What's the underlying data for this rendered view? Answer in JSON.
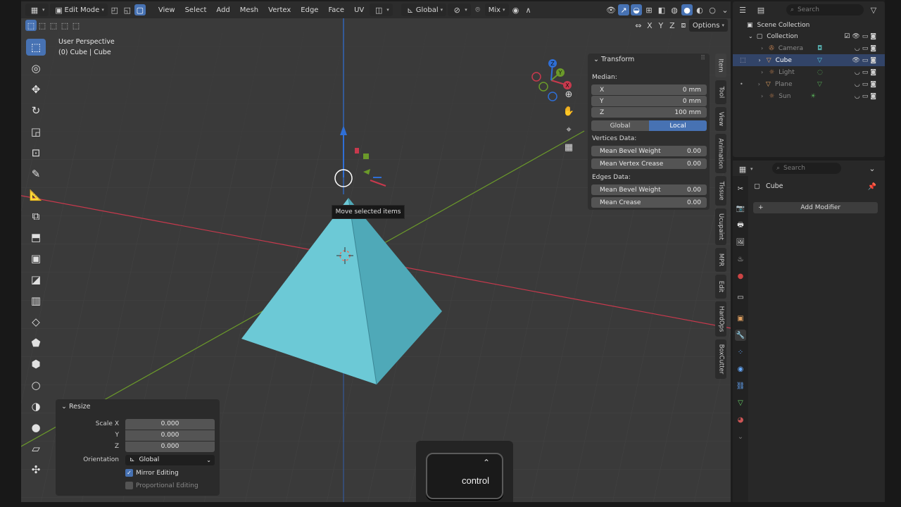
{
  "header": {
    "editor_icon": "▦",
    "mode": "Edit Mode",
    "menus": [
      "View",
      "Select",
      "Add",
      "Mesh",
      "Vertex",
      "Edge",
      "Face",
      "UV"
    ],
    "transform_orientation": "Global",
    "snap_label": "Mix",
    "options_label": "Options",
    "axes": [
      "X",
      "Y",
      "Z"
    ]
  },
  "viewport": {
    "view_name": "User Perspective",
    "object_info": "(0) Cube | Cube",
    "tooltip": "Move selected items",
    "gizmo_axes": [
      "X",
      "Y",
      "Z"
    ]
  },
  "npanel": {
    "section": "Transform",
    "median_label": "Median:",
    "fields": [
      {
        "label": "X",
        "value": "0 mm"
      },
      {
        "label": "Y",
        "value": "0 mm"
      },
      {
        "label": "Z",
        "value": "100 mm"
      }
    ],
    "seg_global": "Global",
    "seg_local": "Local",
    "vertices_label": "Vertices Data:",
    "vertices_fields": [
      {
        "label": "Mean Bevel Weight",
        "value": "0.00"
      },
      {
        "label": "Mean Vertex Crease",
        "value": "0.00"
      }
    ],
    "edges_label": "Edges Data:",
    "edges_fields": [
      {
        "label": "Mean Bevel Weight",
        "value": "0.00"
      },
      {
        "label": "Mean Crease",
        "value": "0.00"
      }
    ],
    "tabs": [
      "Item",
      "Tool",
      "View",
      "Animation",
      "Tissue",
      "Ucupaint",
      "MPR",
      "Edit",
      "HardOps",
      "BoxCutter"
    ]
  },
  "resize_panel": {
    "title": "Resize",
    "scale_x_label": "Scale X",
    "y_label": "Y",
    "z_label": "Z",
    "scale_x": "0.000",
    "scale_y": "0.000",
    "scale_z": "0.000",
    "orientation_label": "Orientation",
    "orientation_value": "Global",
    "mirror_editing": "Mirror Editing",
    "proportional_editing": "Proportional Editing"
  },
  "key_overlay": {
    "key": "control"
  },
  "outliner": {
    "search_placeholder": "Search",
    "scene_collection": "Scene Collection",
    "collection": "Collection",
    "items": [
      {
        "name": "Camera",
        "icon": "camera-icon",
        "color": "#c08050"
      },
      {
        "name": "Cube",
        "icon": "mesh-icon",
        "color": "#e0a060"
      },
      {
        "name": "Light",
        "icon": "light-icon",
        "color": "#c08050"
      },
      {
        "name": "Plane",
        "icon": "mesh-icon",
        "color": "#e0a060"
      },
      {
        "name": "Sun",
        "icon": "light-icon",
        "color": "#c08050"
      }
    ]
  },
  "properties": {
    "search_placeholder": "Search",
    "object_name": "Cube",
    "add_modifier": "Add Modifier"
  },
  "colors": {
    "accent": "#4772b3",
    "selected_row": "#324468",
    "mesh": "#7fd0dc",
    "x_axis": "#c8394d",
    "y_axis": "#6b9a2a",
    "z_axis": "#2f6fd6"
  }
}
